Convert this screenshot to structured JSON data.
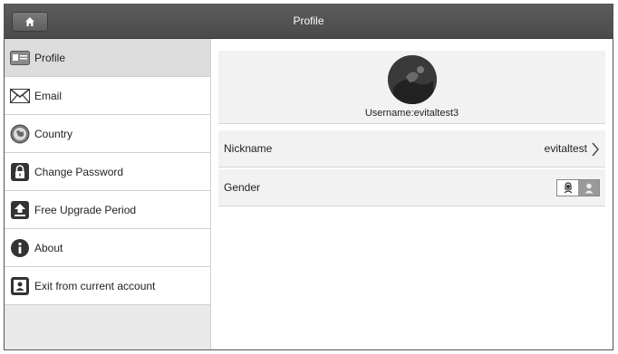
{
  "header": {
    "title": "Profile",
    "home_icon": "home-icon"
  },
  "sidebar": {
    "items": [
      {
        "label": "Profile",
        "icon": "id-card-icon",
        "active": true
      },
      {
        "label": "Email",
        "icon": "envelope-icon"
      },
      {
        "label": "Country",
        "icon": "globe-icon"
      },
      {
        "label": "Change Password",
        "icon": "lock-icon"
      },
      {
        "label": "Free Upgrade Period",
        "icon": "upload-icon"
      },
      {
        "label": "About",
        "icon": "info-icon"
      },
      {
        "label": "Exit from current account",
        "icon": "user-card-icon"
      }
    ]
  },
  "profile": {
    "username": "Username:evitaltest3",
    "nickname_label": "Nickname",
    "nickname_value": "evitaltest",
    "gender_label": "Gender",
    "gender_selected": "female"
  }
}
